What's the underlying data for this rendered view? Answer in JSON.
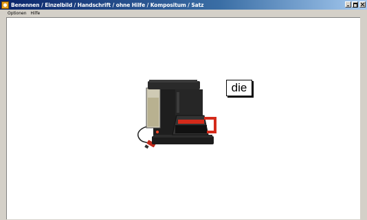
{
  "window": {
    "title": "Benennen / Einzelbild / Handschrift / ohne Hilfe / Kompositum / Satz"
  },
  "menu": {
    "items": [
      "Optionen",
      "Hilfe"
    ]
  },
  "content": {
    "word": "die",
    "picture_icon": "coffee-maker-icon"
  },
  "colors": {
    "titlebar_start": "#0a246a",
    "titlebar_end": "#a6caf0",
    "chrome": "#d4d0c8",
    "accent_red": "#d42a1a"
  }
}
